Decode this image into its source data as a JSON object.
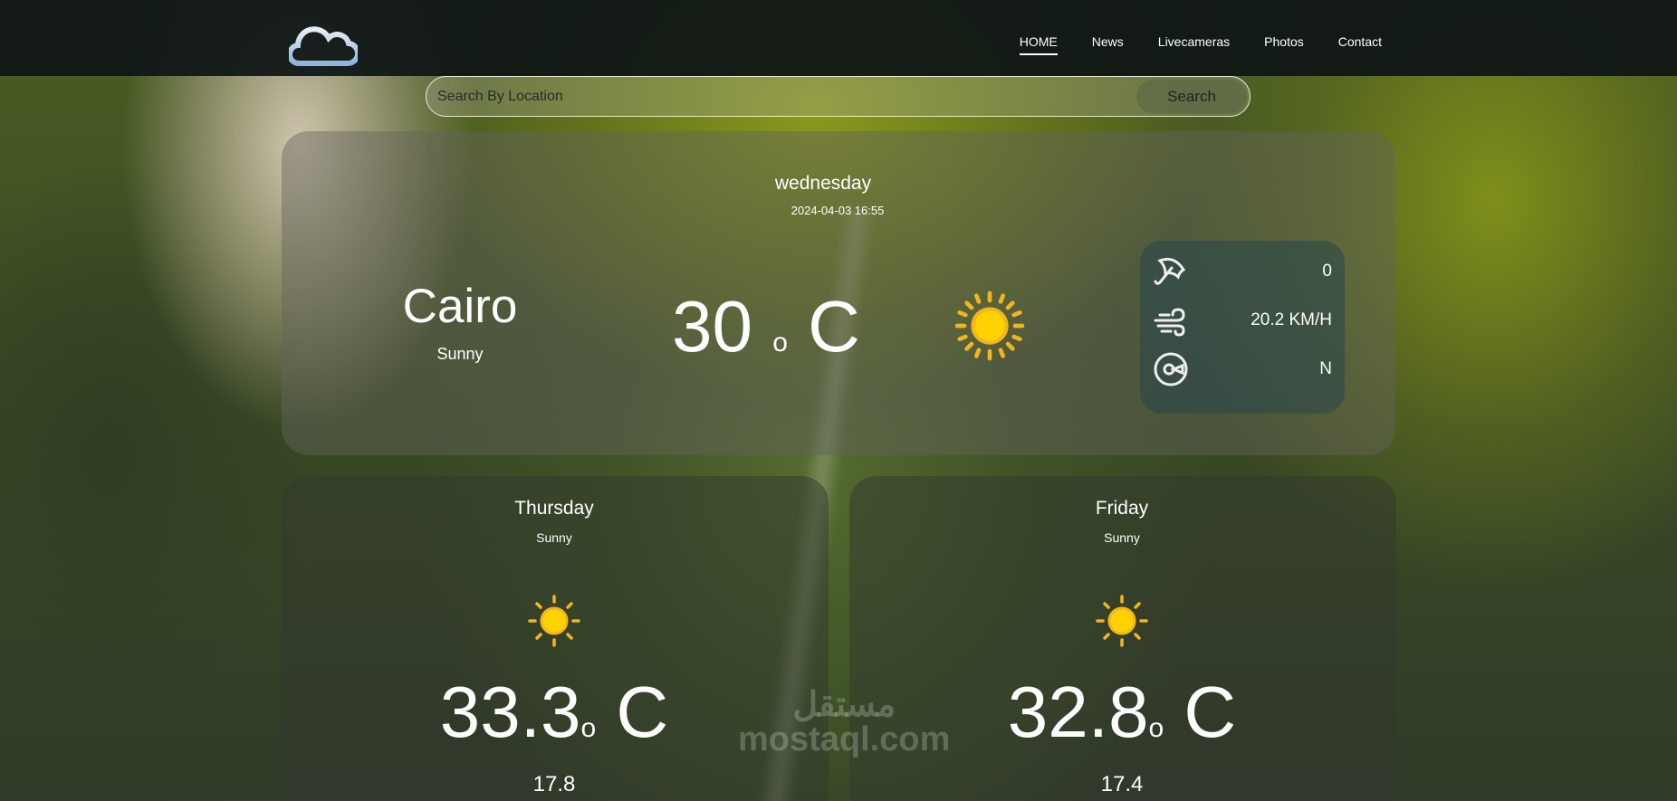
{
  "nav": {
    "items": [
      {
        "label": "HOME",
        "active": true
      },
      {
        "label": "News"
      },
      {
        "label": "Livecameras"
      },
      {
        "label": "Photos"
      },
      {
        "label": "Contact"
      }
    ]
  },
  "search": {
    "placeholder": "Search By Location",
    "value": "",
    "button": "Search"
  },
  "today": {
    "day": "wednesday",
    "datetime": "2024-04-03 16:55",
    "city": "Cairo",
    "condition": "Sunny",
    "temp": "30",
    "deg": "o",
    "unit": "C",
    "icon": "sun-icon",
    "details": {
      "rain": "0",
      "wind_speed": "20.2 KM/H",
      "wind_dir": "N"
    }
  },
  "forecast": [
    {
      "day": "Thursday",
      "condition": "Sunny",
      "max": "33.3",
      "deg": "o",
      "unit": "C",
      "min": "17.8",
      "icon": "sun-icon"
    },
    {
      "day": "Friday",
      "condition": "Sunny",
      "max": "32.8",
      "deg": "o",
      "unit": "C",
      "min": "17.4",
      "icon": "sun-icon"
    }
  ],
  "watermark": {
    "arabic": "مستقل",
    "latin": "mostaql.com"
  },
  "colors": {
    "sun": "#ffd200",
    "sun_ray": "#f3b51c",
    "nav_bg": "#0e1416"
  }
}
